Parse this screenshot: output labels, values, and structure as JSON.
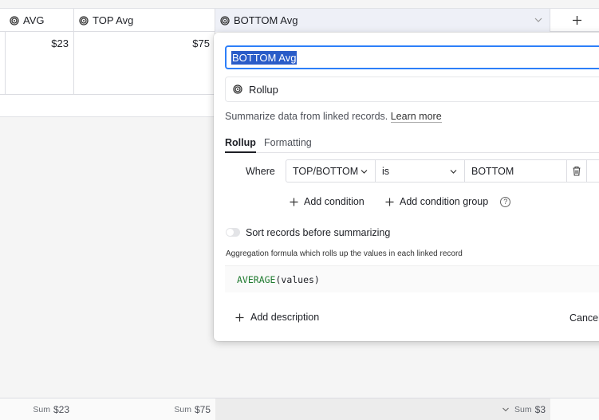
{
  "columns": {
    "avg": "AVG",
    "top_avg": "TOP Avg",
    "bottom_avg": "BOTTOM Avg"
  },
  "row": {
    "avg": "$23",
    "top_avg": "$75"
  },
  "footer": {
    "avg_label": "Sum",
    "avg_value": "$23",
    "top_label": "Sum",
    "top_value": "$75",
    "bottom_label": "Sum",
    "bottom_value": "$3"
  },
  "popup": {
    "field_name": "BOTTOM Avg",
    "field_type": "Rollup",
    "description": "Summarize data from linked records.",
    "learn_more": "Learn more",
    "tabs": [
      "Rollup",
      "Formatting"
    ],
    "condition": {
      "where_label": "Where",
      "field": "TOP/BOTTOM",
      "operator": "is",
      "value": "BOTTOM"
    },
    "add_condition": "Add condition",
    "add_condition_group": "Add condition group",
    "help_glyph": "?",
    "sort_label": "Sort records before summarizing",
    "sort_enabled": false,
    "aggregation_label": "Aggregation formula which rolls up the values in each linked record",
    "formula_fn": "AVERAGE",
    "formula_args": "(values)",
    "add_description": "Add description",
    "cancel": "Cancel"
  },
  "icons": {
    "field_type": "rollup-icon",
    "add_column": "plus-icon"
  },
  "colors": {
    "accent": "#2d7ff9",
    "selection": "#2a5cc8",
    "formula_fn": "#1f7a2f"
  }
}
